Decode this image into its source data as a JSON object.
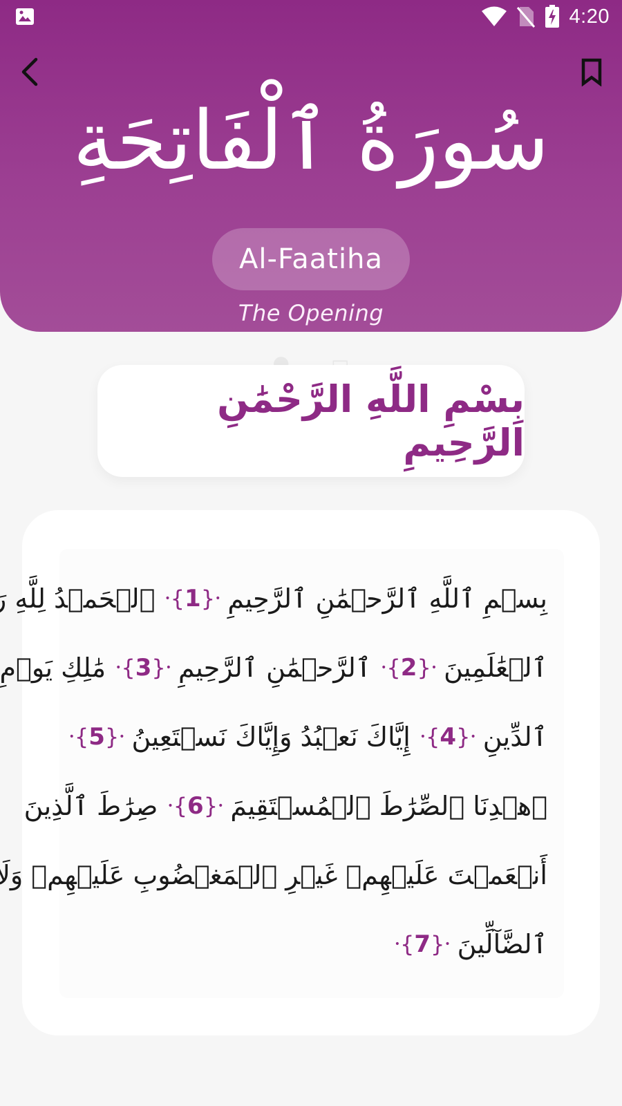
{
  "status_bar": {
    "time": "4:20",
    "icons": [
      "image-icon",
      "wifi-icon",
      "no-sim-icon",
      "battery-charging-icon"
    ]
  },
  "header": {
    "back_icon": "chevron-left-icon",
    "bookmark_icon": "bookmark-icon",
    "surah_arabic": "سُورَةُ ٱلْفَاتِحَةِ",
    "surah_name": "Al-Faatiha",
    "translation": "The Opening"
  },
  "bismillah": "بِسْمِ اللَّهِ الرَّحْمَٰنِ الرَّحِيمِ",
  "verses": {
    "lines": [
      {
        "parts": [
          {
            "text": "بِسۡمِ ٱللَّهِ ٱلرَّحۡمَٰنِ ٱلرَّحِيمِ"
          },
          {
            "ayah": "1"
          },
          {
            "text": "ٱلۡحَمۡدُ لِلَّهِ رَبِّ"
          }
        ]
      },
      {
        "parts": [
          {
            "text": "ٱلۡعَٰلَمِينَ"
          },
          {
            "ayah": "2"
          },
          {
            "text": "ٱلرَّحۡمَٰنِ ٱلرَّحِيمِ"
          },
          {
            "ayah": "3"
          },
          {
            "text": "مَٰلِكِ يَوۡمِ"
          }
        ]
      },
      {
        "parts": [
          {
            "text": "ٱلدِّينِ"
          },
          {
            "ayah": "4"
          },
          {
            "text": "إِيَّاكَ نَعۡبُدُ وَإِيَّاكَ نَسۡتَعِينُ"
          },
          {
            "ayah": "5"
          }
        ]
      },
      {
        "parts": [
          {
            "text": "ٱهۡدِنَا ٱلصِّرَٰطَ ٱلۡمُسۡتَقِيمَ"
          },
          {
            "ayah": "6"
          },
          {
            "text": "صِرَٰطَ ٱلَّذِينَ"
          }
        ]
      },
      {
        "parts": [
          {
            "text": "أَنۡعَمۡتَ عَلَيۡهِمۡ غَيۡرِ ٱلۡمَغۡضُوبِ عَلَيۡهِمۡ وَلَا"
          }
        ]
      },
      {
        "parts": [
          {
            "text": "ٱلضَّآلِّينَ"
          },
          {
            "ayah": "7"
          }
        ]
      }
    ]
  },
  "colors": {
    "accent": "#8e2a85",
    "header_gradient_top": "#8e2a85",
    "header_gradient_bottom": "#a34d98",
    "background": "#f6f6f6"
  }
}
